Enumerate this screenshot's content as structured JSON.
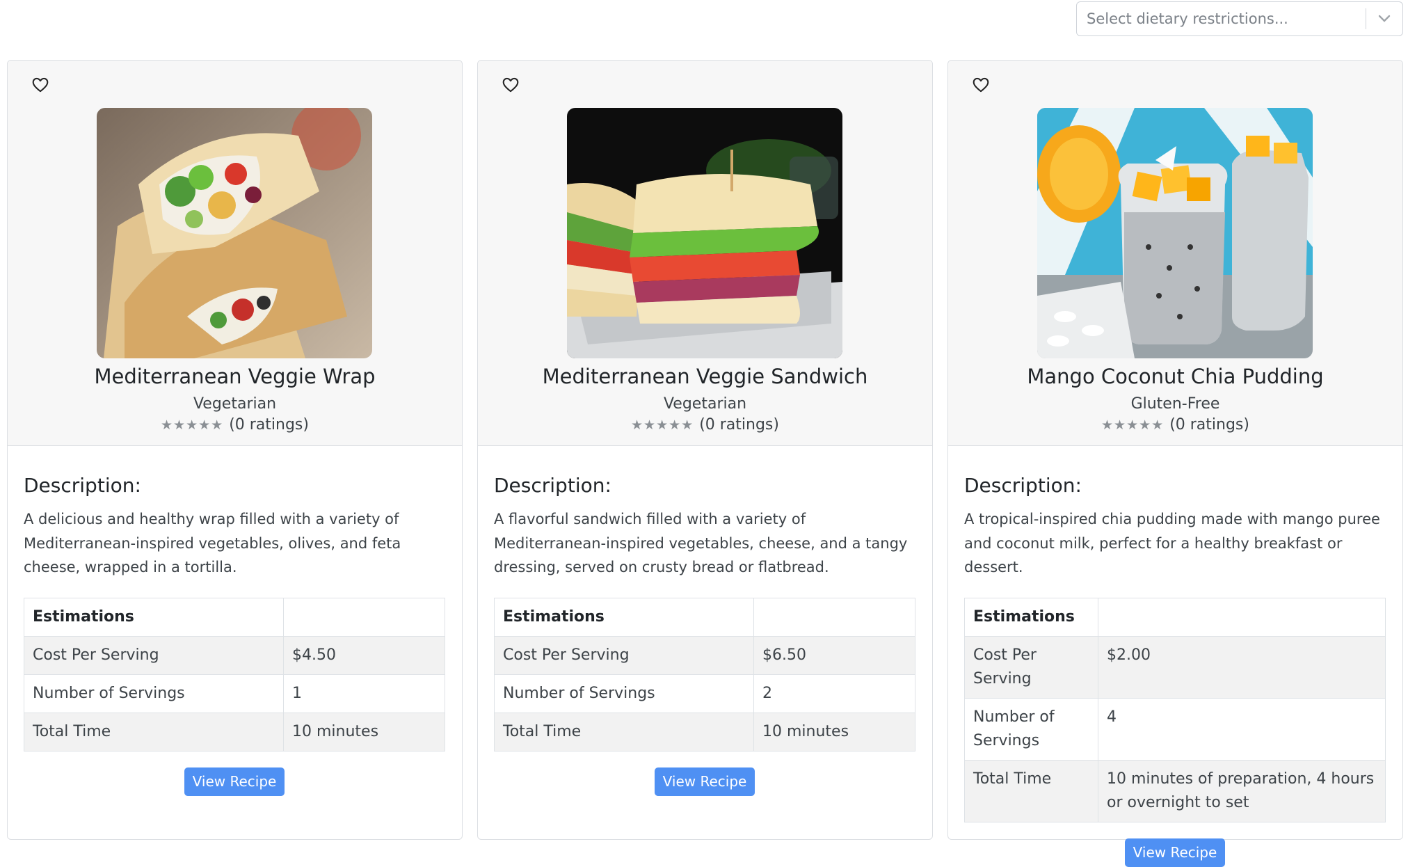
{
  "filter": {
    "placeholder": "Select dietary restrictions..."
  },
  "cards": [
    {
      "title": "Mediterranean Veggie Wrap",
      "tag": "Vegetarian",
      "stars": "★★★★★",
      "rating_text": "(0 ratings)",
      "description_heading": "Description:",
      "description": "A delicious and healthy wrap filled with a variety of Mediterranean-inspired vegetables, olives, and feta cheese, wrapped in a tortilla.",
      "table": {
        "header": "Estimations",
        "rows": [
          {
            "label": "Cost Per Serving",
            "value": "$4.50"
          },
          {
            "label": "Number of Servings",
            "value": "1"
          },
          {
            "label": "Total Time",
            "value": "10 minutes"
          }
        ]
      },
      "button": "View Recipe"
    },
    {
      "title": "Mediterranean Veggie Sandwich",
      "tag": "Vegetarian",
      "stars": "★★★★★",
      "rating_text": "(0 ratings)",
      "description_heading": "Description:",
      "description": "A flavorful sandwich filled with a variety of Mediterranean-inspired vegetables, cheese, and a tangy dressing, served on crusty bread or flatbread.",
      "table": {
        "header": "Estimations",
        "rows": [
          {
            "label": "Cost Per Serving",
            "value": "$6.50"
          },
          {
            "label": "Number of Servings",
            "value": "2"
          },
          {
            "label": "Total Time",
            "value": "10 minutes"
          }
        ]
      },
      "button": "View Recipe"
    },
    {
      "title": "Mango Coconut Chia Pudding",
      "tag": "Gluten-Free",
      "stars": "★★★★★",
      "rating_text": "(0 ratings)",
      "description_heading": "Description:",
      "description": "A tropical-inspired chia pudding made with mango puree and coconut milk, perfect for a healthy breakfast or dessert.",
      "table": {
        "header": "Estimations",
        "rows": [
          {
            "label": "Cost Per Serving",
            "value": "$2.00"
          },
          {
            "label": "Number of Servings",
            "value": "4"
          },
          {
            "label": "Total Time",
            "value": "10 minutes of preparation, 4 hours or overnight to set"
          }
        ]
      },
      "button": "View Recipe"
    }
  ]
}
